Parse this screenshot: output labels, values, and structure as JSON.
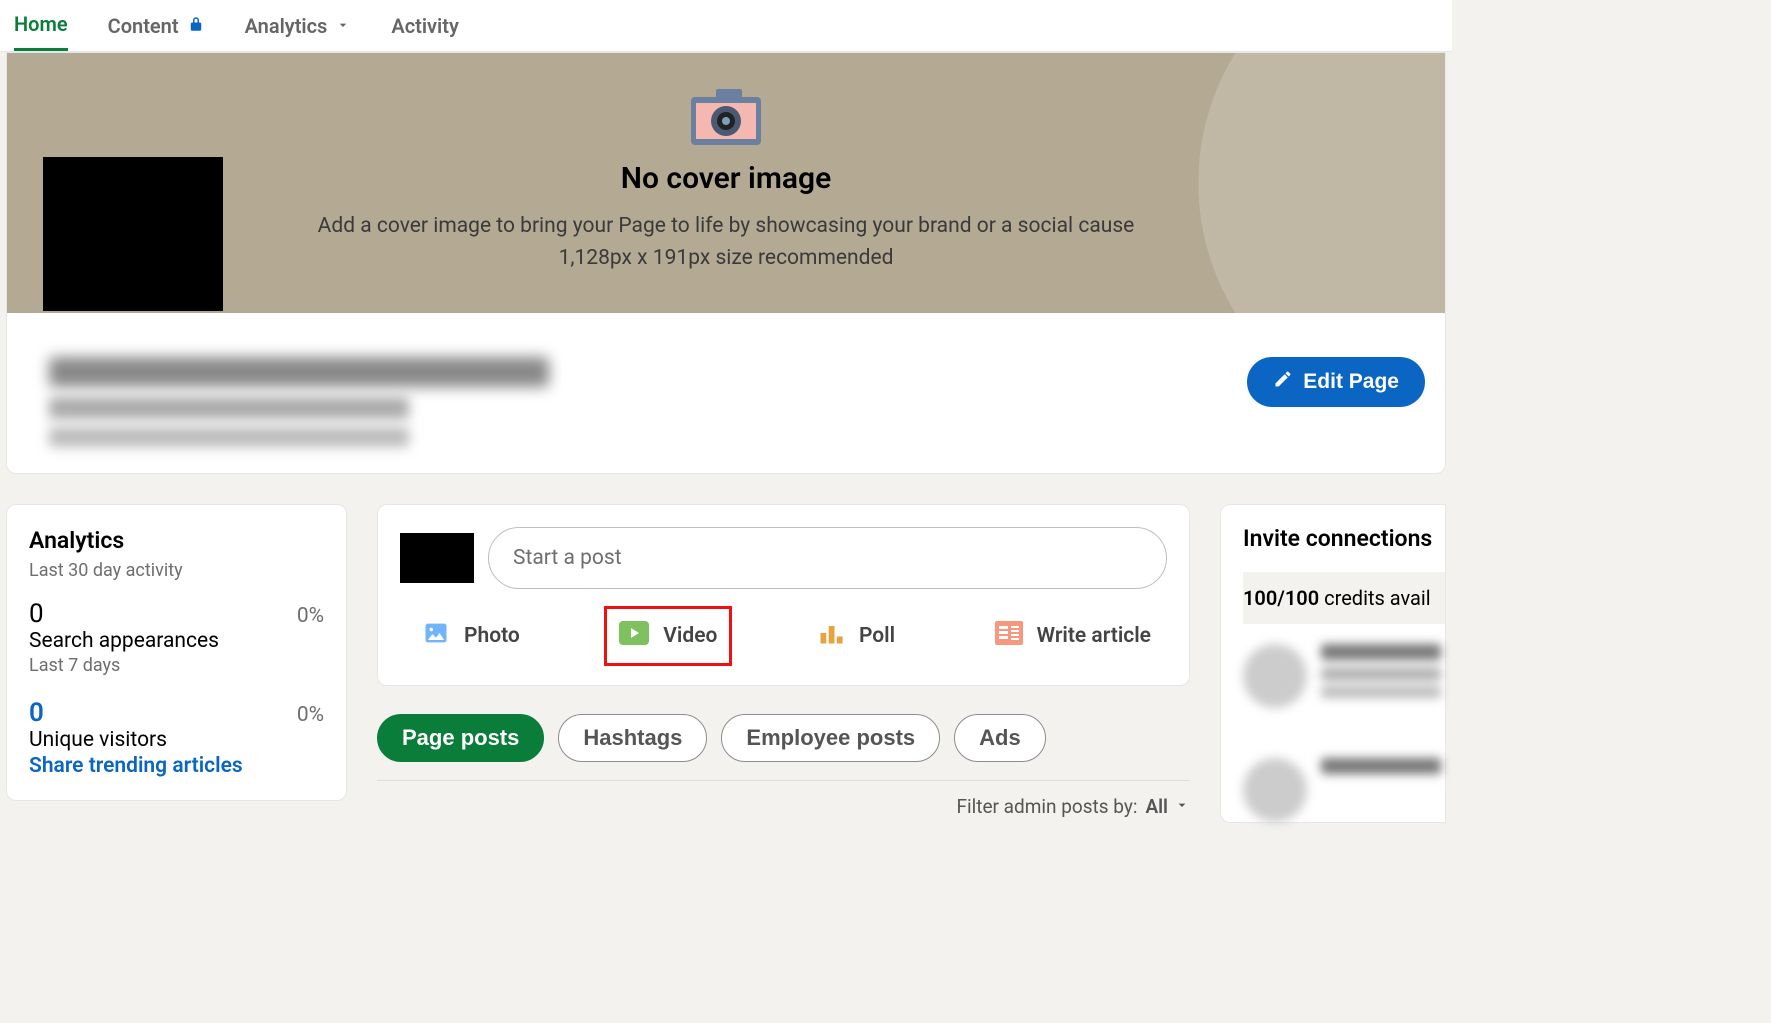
{
  "tabs": {
    "home": "Home",
    "content": "Content",
    "analytics": "Analytics",
    "activity": "Activity"
  },
  "cover": {
    "title": "No cover image",
    "desc": "Add a cover image to bring your Page to life by showcasing your brand or a social cause",
    "size": "1,128px x 191px size recommended"
  },
  "edit_page": "Edit Page",
  "analytics_card": {
    "title": "Analytics",
    "subtitle": "Last 30 day activity",
    "search_val": "0",
    "search_pct": "0%",
    "search_label": "Search appearances",
    "search_sub": "Last 7 days",
    "unique_val": "0",
    "unique_pct": "0%",
    "unique_label": "Unique visitors",
    "trending_link": "Share trending articles"
  },
  "compose": {
    "placeholder": "Start a post",
    "photo": "Photo",
    "video": "Video",
    "poll": "Poll",
    "write": "Write article"
  },
  "pills": {
    "page_posts": "Page posts",
    "hashtags": "Hashtags",
    "employee": "Employee posts",
    "ads": "Ads"
  },
  "filter": {
    "label": "Filter admin posts by:",
    "value": "All"
  },
  "invite": {
    "title": "Invite connections",
    "credits_bold": "100/100",
    "credits_rest": " credits avail"
  }
}
